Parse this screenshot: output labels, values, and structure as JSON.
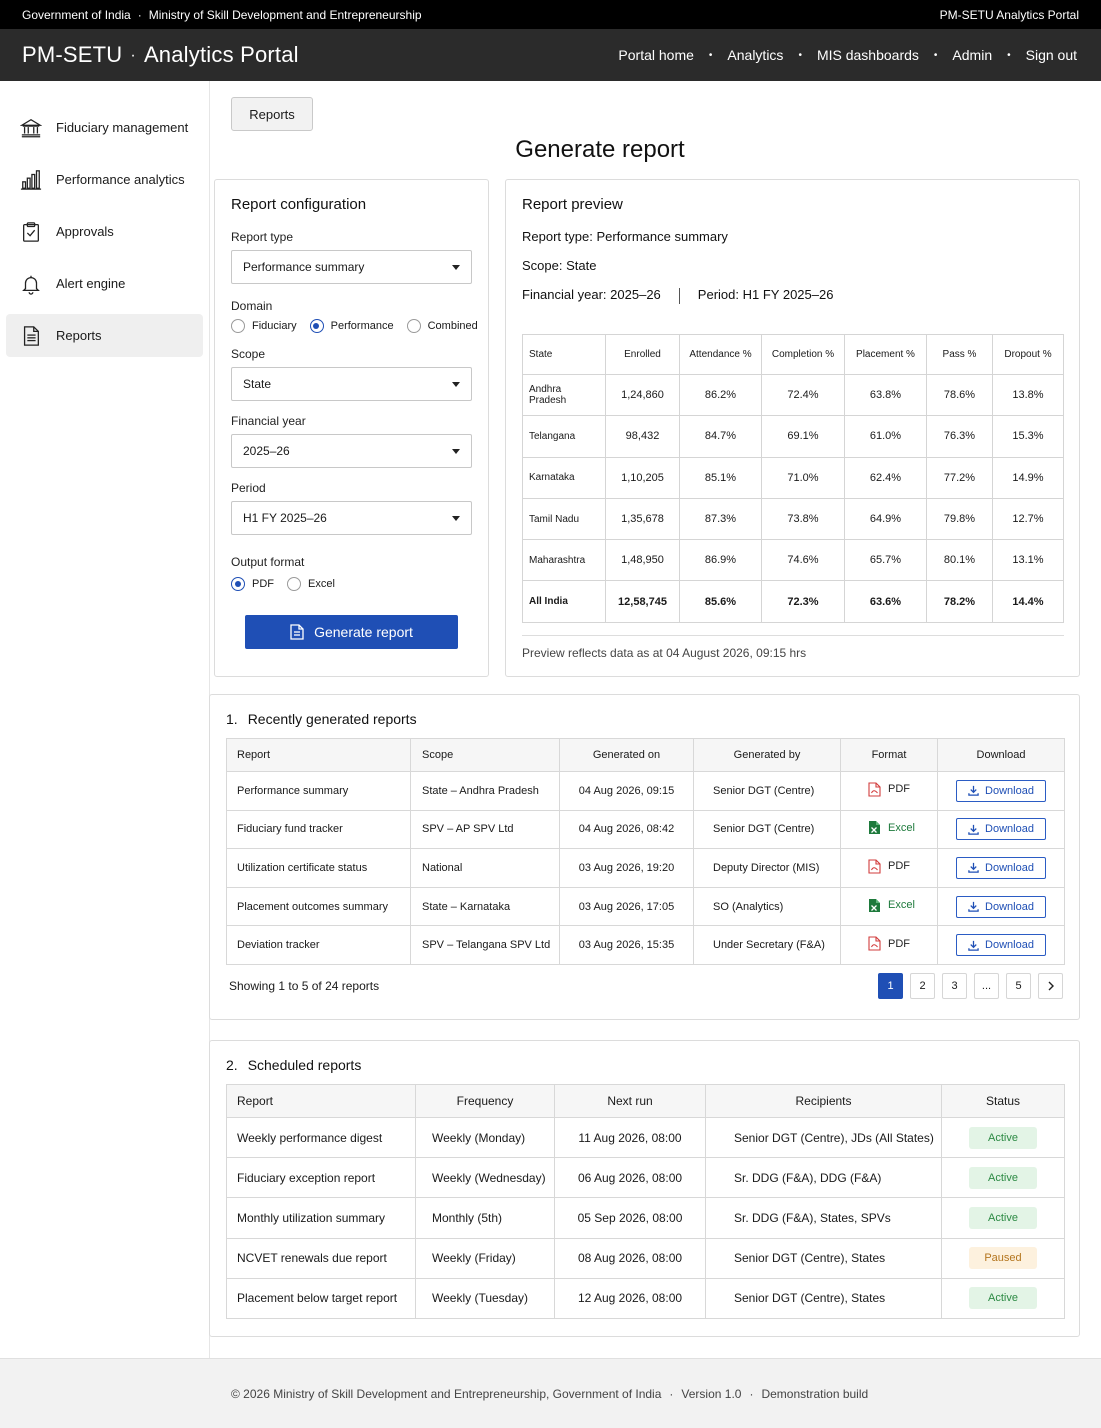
{
  "gov_bar": {
    "left1": "Government of India",
    "left2": "Ministry of Skill Development and Entrepreneurship",
    "right": "PM-SETU Analytics Portal"
  },
  "header": {
    "brand1": "PM-SETU",
    "brand2": "Analytics Portal",
    "nav": [
      "Portal home",
      "Analytics",
      "MIS dashboards",
      "Admin",
      "Sign out"
    ]
  },
  "sidebar": {
    "items": [
      {
        "label": "Fiduciary management",
        "icon": "bank-icon"
      },
      {
        "label": "Performance analytics",
        "icon": "bar-chart-icon"
      },
      {
        "label": "Approvals",
        "icon": "clipboard-check-icon"
      },
      {
        "label": "Alert engine",
        "icon": "bell-icon"
      },
      {
        "label": "Reports",
        "icon": "document-icon",
        "active": true
      }
    ]
  },
  "breadcrumb_button": "Reports",
  "page_title": "Generate report",
  "config": {
    "heading": "Report configuration",
    "report_type_label": "Report type",
    "report_type_value": "Performance summary",
    "domain_label": "Domain",
    "domain_options": [
      "Fiduciary",
      "Performance",
      "Combined"
    ],
    "domain_selected": "Performance",
    "scope_label": "Scope",
    "scope_value": "State",
    "fy_label": "Financial year",
    "fy_value": "2025–26",
    "period_label": "Period",
    "period_value": "H1 FY 2025–26",
    "output_label": "Output format",
    "output_options": [
      "PDF",
      "Excel"
    ],
    "output_selected": "PDF",
    "generate_label": "Generate report"
  },
  "preview": {
    "heading": "Report preview",
    "type_label": "Report type:",
    "type_value": "Performance summary",
    "scope_label": "Scope:",
    "scope_value": "State",
    "fy_label": "Financial year:",
    "fy_value": "2025–26",
    "period_label": "Period:",
    "period_value": "H1 FY 2025–26",
    "columns": [
      "State",
      "Enrolled",
      "Attendance %",
      "Completion %",
      "Placement %",
      "Pass %",
      "Dropout %"
    ],
    "rows": [
      [
        "Andhra Pradesh",
        "1,24,860",
        "86.2%",
        "72.4%",
        "63.8%",
        "78.6%",
        "13.8%"
      ],
      [
        "Telangana",
        "98,432",
        "84.7%",
        "69.1%",
        "61.0%",
        "76.3%",
        "15.3%"
      ],
      [
        "Karnataka",
        "1,10,205",
        "85.1%",
        "71.0%",
        "62.4%",
        "77.2%",
        "14.9%"
      ],
      [
        "Tamil Nadu",
        "1,35,678",
        "87.3%",
        "73.8%",
        "64.9%",
        "79.8%",
        "12.7%"
      ],
      [
        "Maharashtra",
        "1,48,950",
        "86.9%",
        "74.6%",
        "65.7%",
        "80.1%",
        "13.1%"
      ]
    ],
    "total": [
      "All India",
      "12,58,745",
      "85.6%",
      "72.3%",
      "63.6%",
      "78.2%",
      "14.4%"
    ],
    "note": "Preview reflects data as at 04 August 2026, 09:15 hrs"
  },
  "recent": {
    "number": "1.",
    "heading": "Recently generated reports",
    "columns": [
      "Report",
      "Scope",
      "Generated on",
      "Generated by",
      "Format",
      "Download"
    ],
    "rows": [
      {
        "report": "Performance summary",
        "scope": "State – Andhra Pradesh",
        "on": "04 Aug 2026, 09:15",
        "by": "Senior DGT (Centre)",
        "format": "PDF",
        "download": "Download"
      },
      {
        "report": "Fiduciary fund tracker",
        "scope": "SPV – AP SPV Ltd",
        "on": "04 Aug 2026, 08:42",
        "by": "Senior DGT (Centre)",
        "format": "Excel",
        "download": "Download"
      },
      {
        "report": "Utilization certificate status",
        "scope": "National",
        "on": "03 Aug 2026, 19:20",
        "by": "Deputy Director (MIS)",
        "format": "PDF",
        "download": "Download"
      },
      {
        "report": "Placement outcomes summary",
        "scope": "State – Karnataka",
        "on": "03 Aug 2026, 17:05",
        "by": "SO (Analytics)",
        "format": "Excel",
        "download": "Download"
      },
      {
        "report": "Deviation tracker",
        "scope": "SPV – Telangana SPV Ltd",
        "on": "03 Aug 2026, 15:35",
        "by": "Under Secretary (F&A)",
        "format": "PDF",
        "download": "Download"
      }
    ],
    "showing": "Showing 1 to 5 of 24 reports",
    "pages": [
      "1",
      "2",
      "3",
      "...",
      "5"
    ],
    "current_page": "1"
  },
  "scheduled": {
    "number": "2.",
    "heading": "Scheduled reports",
    "columns": [
      "Report",
      "Frequency",
      "Next run",
      "Recipients",
      "Status"
    ],
    "rows": [
      {
        "report": "Weekly performance digest",
        "frequency": "Weekly (Monday)",
        "next": "11 Aug 2026, 08:00",
        "recipients": "Senior DGT (Centre), JDs (All States)",
        "status": "Active"
      },
      {
        "report": "Fiduciary exception report",
        "frequency": "Weekly (Wednesday)",
        "next": "06 Aug 2026, 08:00",
        "recipients": "Sr. DDG (F&A), DDG (F&A)",
        "status": "Active"
      },
      {
        "report": "Monthly utilization summary",
        "frequency": "Monthly (5th)",
        "next": "05 Sep 2026, 08:00",
        "recipients": "Sr. DDG (F&A), States, SPVs",
        "status": "Active"
      },
      {
        "report": "NCVET renewals due report",
        "frequency": "Weekly (Friday)",
        "next": "08 Aug 2026, 08:00",
        "recipients": "Senior DGT (Centre), States",
        "status": "Paused"
      },
      {
        "report": "Placement below target report",
        "frequency": "Weekly (Tuesday)",
        "next": "12 Aug 2026, 08:00",
        "recipients": "Senior DGT (Centre), States",
        "status": "Active"
      }
    ]
  },
  "footer": {
    "copyright": "© 2026 Ministry of Skill Development and Entrepreneurship, Government of India",
    "version": "Version 1.0",
    "build": "Demonstration build"
  },
  "colors": {
    "primary": "#1f4fb5",
    "header_bg": "#2b2b2b",
    "topbar_bg": "#000000",
    "active_badge": "#2c8a44",
    "paused_badge": "#b4751e",
    "excel_green": "#1e7a3c",
    "pdf_red": "#d23c3c"
  }
}
